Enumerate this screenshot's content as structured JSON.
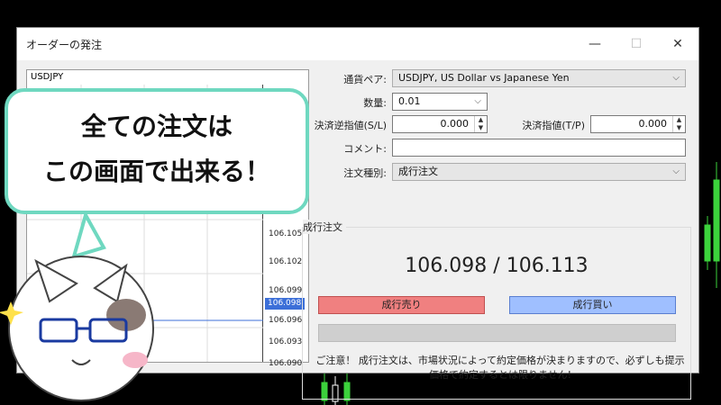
{
  "window": {
    "title": "オーダーの発注",
    "minimize_icon": "minimize-icon",
    "maximize_icon": "maximize-icon",
    "close_icon": "close-icon"
  },
  "chart": {
    "symbol": "USDJPY",
    "price_labels": [
      "106.105",
      "106.102",
      "106.099",
      "106.096",
      "106.093",
      "106.090"
    ],
    "current_price": "106.098"
  },
  "form": {
    "symbol_label": "通貨ペア:",
    "symbol_value": "USDJPY, US Dollar vs Japanese Yen",
    "volume_label": "数量:",
    "volume_value": "0.01",
    "sl_label": "決済逆指値(S/L)",
    "sl_value": "0.000",
    "tp_label": "決済指値(T/P)",
    "tp_value": "0.000",
    "comment_label": "コメント:",
    "comment_value": "",
    "type_label": "注文種別:",
    "type_value": "成行注文"
  },
  "market": {
    "section_title": "成行注文",
    "bid": "106.098",
    "ask": "106.113",
    "separator": "/",
    "sell_label": "成行売り",
    "buy_label": "成行買い",
    "note_line1": "ご注意！ 成行注文は、市場状況によって約定価格が決まりますので、必ずしも提示",
    "note_line2": "価格で約定するとは限りません!"
  },
  "overlay": {
    "line1": "全ての注文は",
    "line2": "この画面で出来る！"
  },
  "colors": {
    "bubble_border": "#6fd8c0",
    "sell": "#f08080",
    "buy": "#9fbfff",
    "candle_green": "#3cd23c"
  }
}
